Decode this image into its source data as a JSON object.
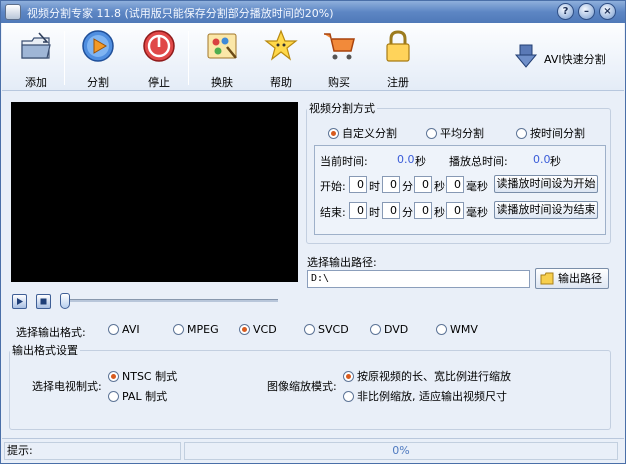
{
  "window": {
    "title": "视频分割专家 11.8 (试用版只能保存分割部分播放时间的20%)"
  },
  "titlebar_buttons": {
    "help": "?",
    "minimize": "–",
    "close": "×"
  },
  "toolbar": {
    "add": "添加",
    "split": "分割",
    "stop": "停止",
    "skin": "换肤",
    "help": "帮助",
    "buy": "购买",
    "register": "注册",
    "avi_split": "AVI快速分割"
  },
  "split_mode": {
    "legend": "视频分割方式",
    "options": [
      "自定义分割",
      "平均分割",
      "按时间分割"
    ],
    "selected": 0,
    "current_time_label": "当前时间:",
    "current_time_value": "0.0",
    "current_time_unit": "秒",
    "total_time_label": "播放总时间:",
    "total_time_value": "0.0",
    "total_time_unit": "秒",
    "start_label": "开始:",
    "end_label": "结束:",
    "hour_unit": "时",
    "minute_unit": "分",
    "second_unit": "秒",
    "ms_unit": "毫秒",
    "start": {
      "h": "0",
      "m": "0",
      "s": "0",
      "ms": "0"
    },
    "end": {
      "h": "0",
      "m": "0",
      "s": "0",
      "ms": "0"
    },
    "set_start_button": "读播放时间设为开始",
    "set_end_button": "读播放时间设为结束"
  },
  "output_path": {
    "label": "选择输出路径:",
    "value": "D:\\",
    "button": "输出路径"
  },
  "output_format": {
    "label": "选择输出格式:",
    "options": [
      "AVI",
      "MPEG",
      "VCD",
      "SVCD",
      "DVD",
      "WMV"
    ],
    "selected": 2
  },
  "format_settings": {
    "legend": "输出格式设置",
    "tv_label": "选择电视制式:",
    "tv_options": [
      "NTSC 制式",
      "PAL  制式"
    ],
    "tv_selected": 0,
    "scale_label": "图像缩放模式:",
    "scale_options": [
      "按原视频的长、宽比例进行缩放",
      "非比例缩放, 适应输出视频尺寸"
    ],
    "scale_selected": 0
  },
  "status": {
    "hint_label": "提示:",
    "progress_text": "0%",
    "progress": 0
  },
  "colors": {
    "accent_radio": "#d85b1e",
    "time_value": "#3a5cd8",
    "title_bar": "#5d86c4"
  }
}
